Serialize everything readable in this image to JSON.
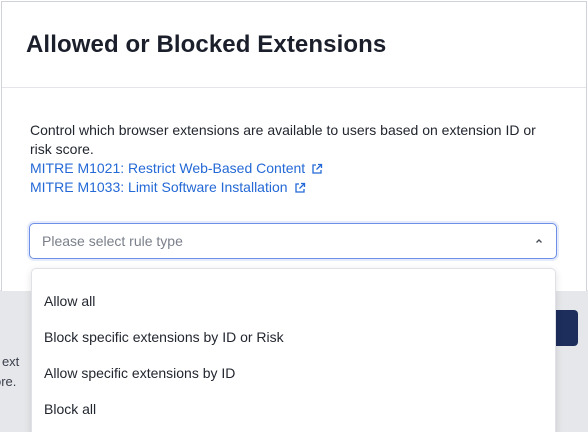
{
  "modal": {
    "title": "Allowed or Blocked Extensions",
    "description": "Control which browser extensions are available to users based on extension ID or risk score.",
    "links": [
      {
        "label": "MITRE M1021: Restrict Web-Based Content"
      },
      {
        "label": "MITRE M1033: Limit Software Installation"
      }
    ]
  },
  "rule_type_select": {
    "placeholder": "Please select rule type",
    "options": [
      {
        "label": "Allow all"
      },
      {
        "label": "Block specific extensions by ID or Risk"
      },
      {
        "label": "Allow specific extensions by ID"
      },
      {
        "label": "Block all"
      }
    ]
  },
  "background": {
    "text_fragment": "r ext\nore."
  },
  "colors": {
    "link": "#2469d6",
    "primary_button": "#1d2d5c",
    "select_border": "#6e8fe6"
  }
}
